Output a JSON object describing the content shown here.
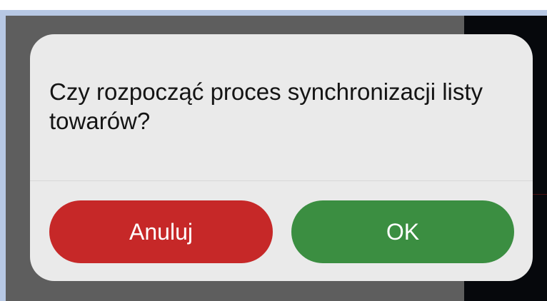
{
  "dialog": {
    "message": "Czy rozpocząć proces synchronizacji listy towarów?",
    "cancel_label": "Anuluj",
    "ok_label": "OK"
  },
  "colors": {
    "cancel_button": "#c62828",
    "ok_button": "#3b8e41",
    "dialog_background": "#eaeaea",
    "scrim": "#5e5e5e"
  }
}
